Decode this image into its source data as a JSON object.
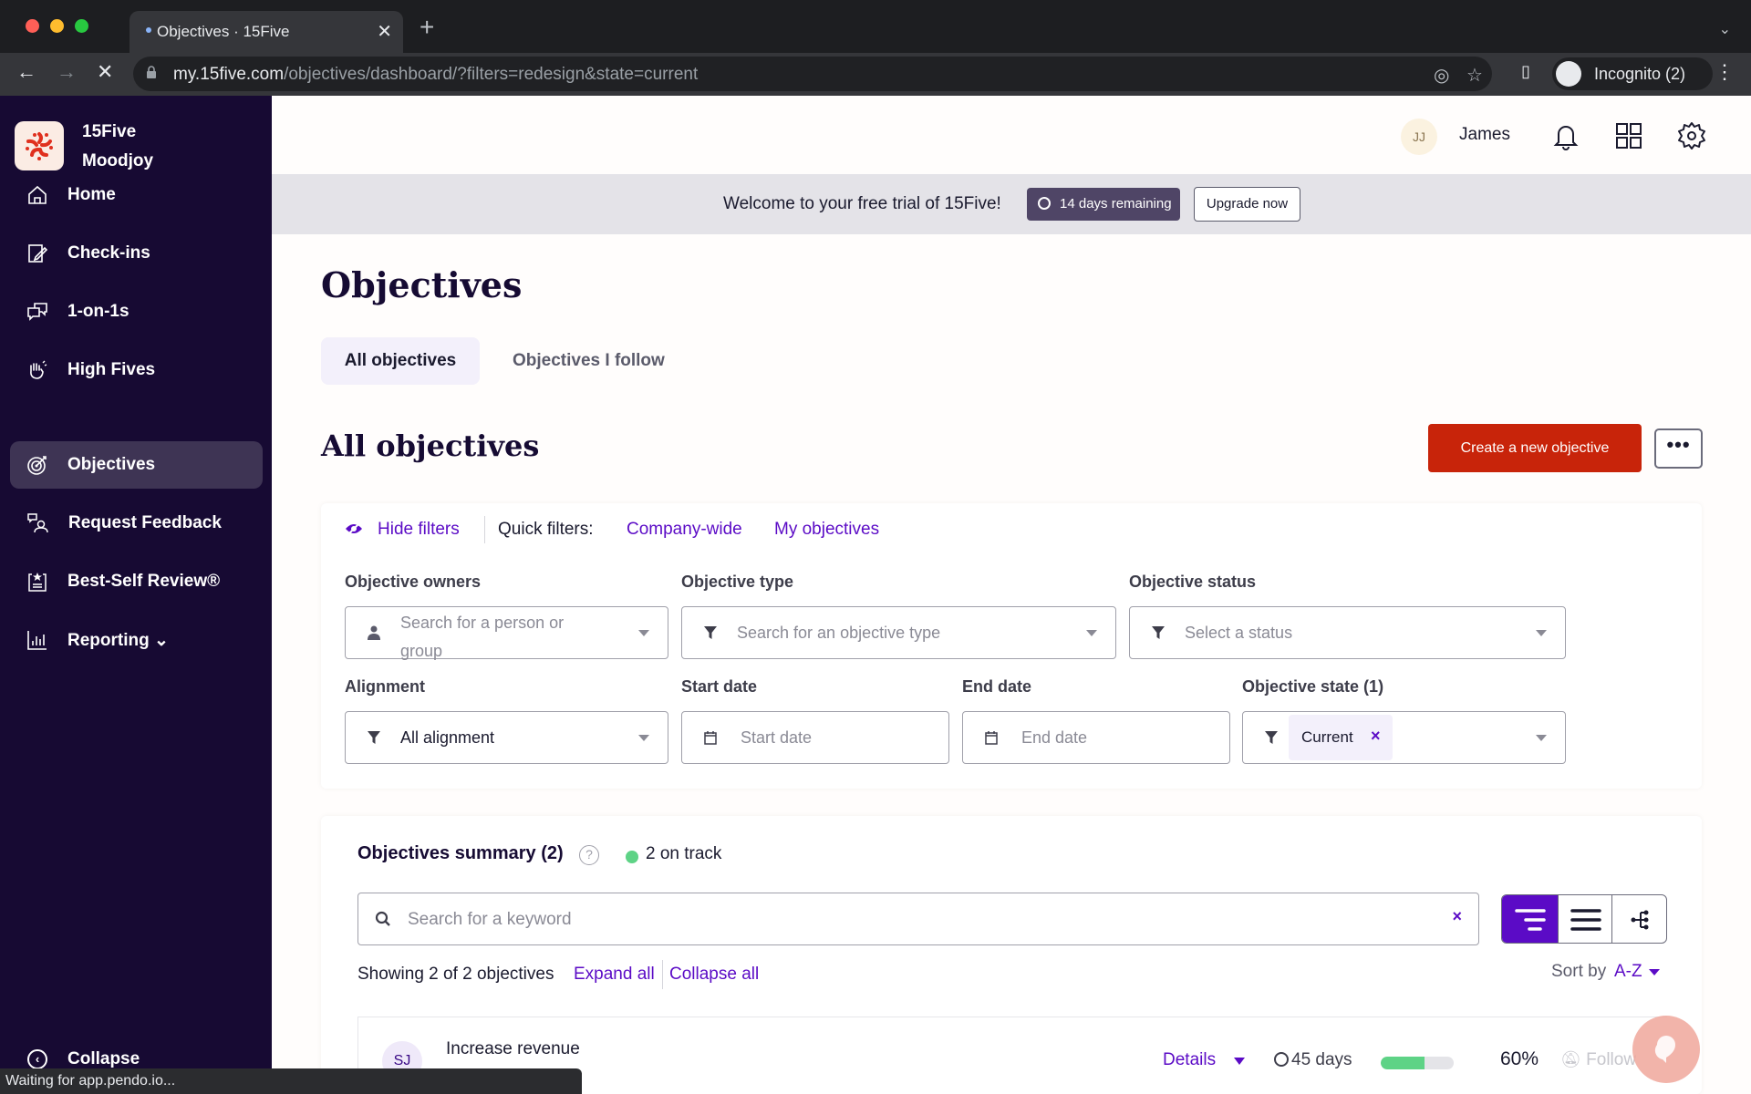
{
  "browser": {
    "tab_title": "Objectives · 15Five",
    "url_host": "my.15five.com",
    "url_path": "/objectives/dashboard/?filters=redesign&state=current",
    "profile_label": "Incognito (2)",
    "status_text": "Waiting for app.pendo.io..."
  },
  "sidebar": {
    "org_line1": "15Five",
    "org_line2": "Moodjoy",
    "items": [
      {
        "label": "Home",
        "icon": "home-icon"
      },
      {
        "label": "Check-ins",
        "icon": "check-ins-icon"
      },
      {
        "label": "1-on-1s",
        "icon": "chat-bubbles-icon"
      },
      {
        "label": "High Fives",
        "icon": "high-five-hand-icon"
      },
      {
        "label": "Objectives",
        "icon": "target-icon",
        "active": true
      },
      {
        "label": "Request Feedback",
        "icon": "feedback-person-icon"
      },
      {
        "label": "Best-Self Review®",
        "icon": "review-clipboard-icon"
      },
      {
        "label": "Reporting ⌄",
        "icon": "bar-chart-icon"
      }
    ],
    "collapse_label": "Collapse"
  },
  "header": {
    "user_initials": "JJ",
    "user_name": "James"
  },
  "banner": {
    "message": "Welcome to your free trial of 15Five!",
    "trial_badge": "14 days remaining",
    "upgrade_label": "Upgrade now"
  },
  "page": {
    "title": "Objectives",
    "tabs": [
      {
        "label": "All objectives",
        "active": true
      },
      {
        "label": "Objectives I follow",
        "active": false
      }
    ],
    "section_title": "All objectives",
    "create_label": "Create a new objective",
    "more_label": "•••"
  },
  "filters": {
    "hide_label": "Hide filters",
    "quick_label": "Quick filters:",
    "quick_links": [
      "Company-wide",
      "My objectives"
    ],
    "owners": {
      "label": "Objective owners",
      "placeholder_line1": "Search for a person or",
      "placeholder_line2": "group"
    },
    "type": {
      "label": "Objective type",
      "placeholder": "Search for an objective type"
    },
    "status": {
      "label": "Objective status",
      "placeholder": "Select a status"
    },
    "alignment": {
      "label": "Alignment",
      "value": "All alignment"
    },
    "start_date": {
      "label": "Start date",
      "placeholder": "Start date"
    },
    "end_date": {
      "label": "End date",
      "placeholder": "End date"
    },
    "state": {
      "label": "Objective state (1)",
      "chip": "Current",
      "chip_remove": "×"
    }
  },
  "summary": {
    "title": "Objectives summary (2)",
    "help": "?",
    "on_track": "2 on track",
    "on_track_color": "#5ed386",
    "search_placeholder": "Search for a keyword",
    "search_clear": "×",
    "showing": "Showing 2 of 2 objectives",
    "expand_all": "Expand all",
    "collapse_all": "Collapse all",
    "sort_label": "Sort by",
    "sort_value": "A-Z",
    "objectives": [
      {
        "owner_initials": "SJ",
        "title": "Increase revenue",
        "details_label": "Details",
        "days": "45 days",
        "progress_pct": 60,
        "progress_label": "60%",
        "follow_label": "Follow"
      }
    ]
  },
  "colors": {
    "brand_purple": "#5b0bc6",
    "sidebar_bg": "#170a33",
    "create_red": "#c8240a",
    "on_track_green": "#5ed386"
  }
}
